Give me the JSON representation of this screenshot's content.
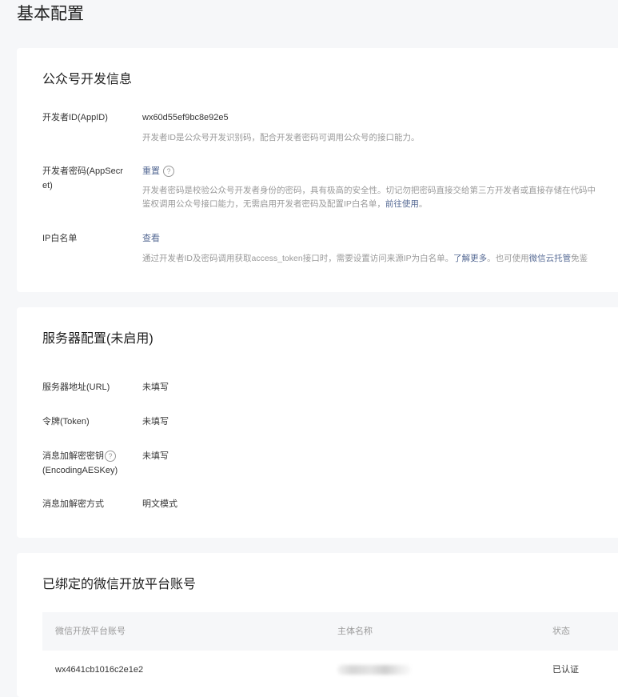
{
  "page": {
    "title": "基本配置"
  },
  "dev_info": {
    "title": "公众号开发信息",
    "appid": {
      "label": "开发者ID(AppID)",
      "value": "wx60d55ef9bc8e92e5",
      "desc": "开发者ID是公众号开发识别码，配合开发者密码可调用公众号的接口能力。"
    },
    "secret": {
      "label": "开发者密码(AppSecret)",
      "action": "重置",
      "help": "?",
      "desc_line1": "开发者密码是校验公众号开发者身份的密码，具有极高的安全性。切记勿把密码直接交给第三方开发者或直接存储在代码中",
      "desc_line2_prefix": "鉴权调用公众号接口能力，无需启用开发者密码及配置IP白名单，",
      "desc_line2_link": "前往使用",
      "desc_line2_suffix": "。"
    },
    "ip": {
      "label": "IP白名单",
      "action": "查看",
      "desc_prefix": "通过开发者ID及密码调用获取access_token接口时，需要设置访问来源IP为白名单。",
      "desc_link1": "了解更多",
      "desc_middle": "。也可使用",
      "desc_link2": "微信云托管",
      "desc_suffix": "免鉴"
    }
  },
  "server": {
    "title": "服务器配置(未启用)",
    "url": {
      "label": "服务器地址(URL)",
      "value": "未填写"
    },
    "token": {
      "label": "令牌(Token)",
      "value": "未填写"
    },
    "aes": {
      "label": "消息加解密密钥",
      "label2": "(EncodingAESKey)",
      "help": "?",
      "value": "未填写"
    },
    "mode": {
      "label": "消息加解密方式",
      "value": "明文模式"
    }
  },
  "open_platform": {
    "title": "已绑定的微信开放平台账号",
    "columns": [
      "微信开放平台账号",
      "主体名称",
      "状态"
    ],
    "rows": [
      {
        "account": "wx4641cb1016c2e1e2",
        "status": "已认证"
      }
    ]
  }
}
